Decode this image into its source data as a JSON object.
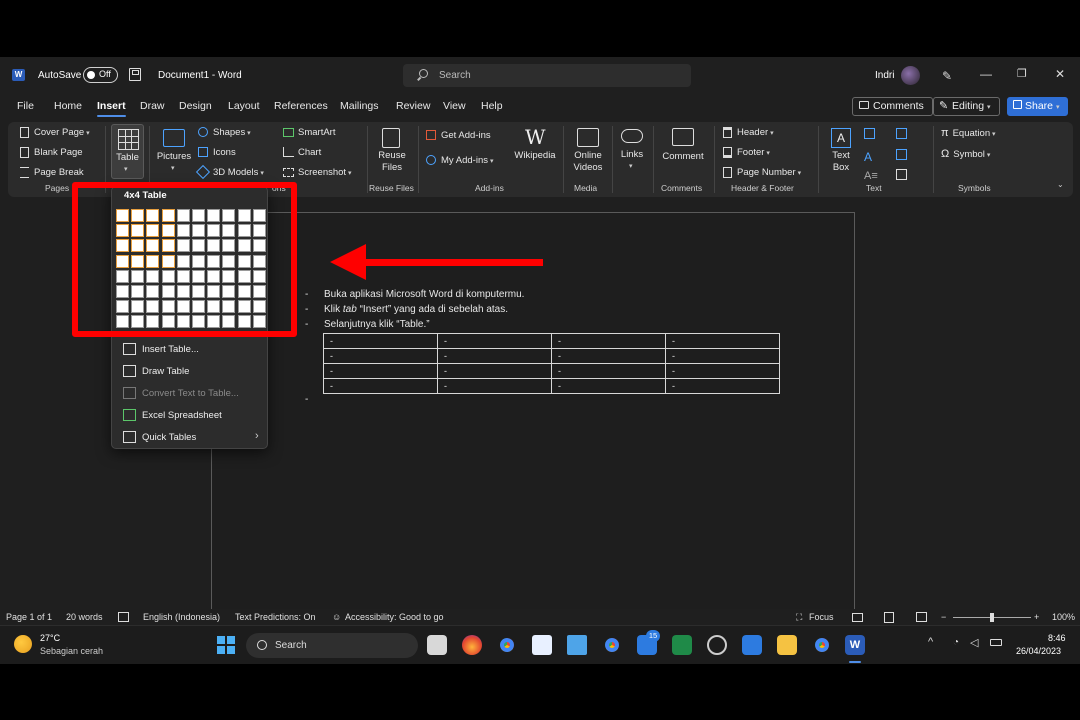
{
  "titlebar": {
    "autosave_label": "AutoSave",
    "autosave_state": "Off",
    "document_title": "Document1  -  Word",
    "search_placeholder": "Search",
    "user_name": "Indri"
  },
  "menu": {
    "tabs": [
      "File",
      "Home",
      "Insert",
      "Draw",
      "Design",
      "Layout",
      "References",
      "Mailings",
      "Review",
      "View",
      "Help"
    ],
    "active_tab": "Insert",
    "comments_label": "Comments",
    "editing_label": "Editing",
    "share_label": "Share"
  },
  "ribbon": {
    "pages": {
      "cover_page": "Cover Page",
      "blank_page": "Blank Page",
      "page_break": "Page Break",
      "group": "Pages"
    },
    "table": {
      "label": "Table"
    },
    "illustrations": {
      "pictures": "Pictures",
      "shapes": "Shapes",
      "icons": "Icons",
      "models": "3D Models",
      "smartart": "SmartArt",
      "chart": "Chart",
      "screenshot": "Screenshot",
      "group_tail": "ons"
    },
    "reuse": {
      "label_line1": "Reuse",
      "label_line2": "Files",
      "group": "Reuse Files"
    },
    "addins": {
      "get": "Get Add-ins",
      "my": "My Add-ins",
      "wikipedia": "Wikipedia",
      "group": "Add-ins"
    },
    "media": {
      "label_line1": "Online",
      "label_line2": "Videos",
      "group": "Media"
    },
    "links": {
      "label": "Links"
    },
    "comments": {
      "label": "Comment",
      "group": "Comments"
    },
    "header_footer": {
      "header": "Header",
      "footer": "Footer",
      "page_number": "Page Number",
      "group": "Header & Footer"
    },
    "text": {
      "label_line1": "Text",
      "label_line2": "Box",
      "group": "Text"
    },
    "symbols": {
      "equation": "Equation",
      "symbol": "Symbol",
      "group": "Symbols"
    }
  },
  "table_dropdown": {
    "title": "4x4 Table",
    "grid_cols": 10,
    "grid_rows": 8,
    "selected_cols": 4,
    "selected_rows": 4,
    "items": [
      {
        "label": "Insert Table...",
        "enabled": true
      },
      {
        "label": "Draw Table",
        "enabled": true
      },
      {
        "label": "Convert Text to Table...",
        "enabled": false
      },
      {
        "label": "Excel Spreadsheet",
        "enabled": true
      },
      {
        "label": "Quick Tables",
        "enabled": true
      }
    ]
  },
  "document": {
    "lines": [
      {
        "dash": "-",
        "text": "Buka aplikasi Microsoft Word di komputermu."
      },
      {
        "dash": "-",
        "text_before": "Klik ",
        "text_italic": "tab",
        "text_after": " “Insert” yang ada di sebelah atas."
      },
      {
        "dash": "-",
        "text": "Selanjutnya klik “Table.”"
      }
    ],
    "table": [
      [
        "-",
        "-",
        "-",
        "-"
      ],
      [
        "-",
        "-",
        "-",
        "-"
      ],
      [
        "-",
        "-",
        "-",
        "-"
      ],
      [
        "-",
        "-",
        "-",
        "-"
      ]
    ],
    "trailing_dash": "-"
  },
  "statusbar": {
    "page": "Page 1 of 1",
    "words": "20 words",
    "language": "English (Indonesia)",
    "predictions": "Text Predictions: On",
    "accessibility": "Accessibility: Good to go",
    "focus": "Focus",
    "zoom": "100%"
  },
  "taskbar": {
    "temperature": "27°C",
    "weather": "Sebagian cerah",
    "search_label": "Search",
    "badge_count": "15",
    "time": "8:46",
    "date": "26/04/2023"
  },
  "colors": {
    "accent_blue": "#2f6fd6",
    "annotation_red": "#ff0000",
    "grid_selected_border": "#e8a040"
  }
}
